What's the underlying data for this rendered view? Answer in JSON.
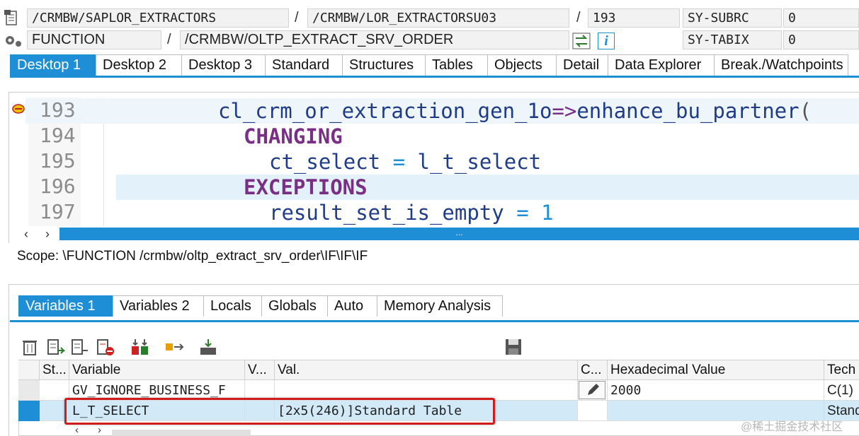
{
  "header": {
    "program": "/CRMBW/SAPLOR_EXTRACTORS",
    "include": "/CRMBW/LOR_EXTRACTORSU03",
    "line": "193",
    "sy_subrc_label": "SY-SUBRC",
    "sy_subrc_value": "0",
    "event_type": "FUNCTION",
    "event_name": "/CRMBW/OLTP_EXTRACT_SRV_ORDER",
    "sy_tabix_label": "SY-TABIX",
    "sy_tabix_value": "0",
    "slash": "/",
    "info_label": "i"
  },
  "desktop_tabs": [
    "Desktop 1",
    "Desktop 2",
    "Desktop 3",
    "Standard",
    "Structures",
    "Tables",
    "Objects",
    "Detail",
    "Data Explorer",
    "Break./Watchpoints"
  ],
  "code": {
    "lines": [
      {
        "num": "193",
        "text": "cl_crm_or_extraction_gen_1o=>enhance_bu_partner("
      },
      {
        "num": "194",
        "text": "CHANGING"
      },
      {
        "num": "195",
        "text": "ct_select = l_t_select"
      },
      {
        "num": "196",
        "text": "EXCEPTIONS"
      },
      {
        "num": "197",
        "text": "result_set_is_empty = 1"
      }
    ],
    "ellipsis": "..."
  },
  "scope": "Scope: \\FUNCTION /crmbw/oltp_extract_srv_order\\IF\\IF\\IF",
  "variable_tabs": [
    "Variables 1",
    "Variables 2",
    "Locals",
    "Globals",
    "Auto",
    "Memory Analysis"
  ],
  "toolbar_icons": [
    "delete-icon",
    "new-line-icon",
    "insert-line-icon",
    "delete-line-icon",
    "compare-icon",
    "move-icon",
    "load-icon",
    "save-icon"
  ],
  "grid": {
    "headers": [
      "St...",
      "Variable",
      "V...",
      "Val.",
      "C...",
      "Hexadecimal Value",
      "Tech"
    ],
    "rows": [
      {
        "variable": "GV_IGNORE_BUSINESS_F",
        "value": "",
        "hex": "2000",
        "tech": "C(1)"
      },
      {
        "variable": "L_T_SELECT",
        "value": "[2x5(246)]Standard Table",
        "hex": "",
        "tech": "Stand"
      }
    ]
  },
  "watermark": "@稀土掘金技术社区",
  "colors": {
    "accent": "#1e8fd6",
    "keyword": "#7a2f86",
    "highlight": "#e3f1fb",
    "selection": "#d2e9f8",
    "red_box": "#d01c1c"
  }
}
